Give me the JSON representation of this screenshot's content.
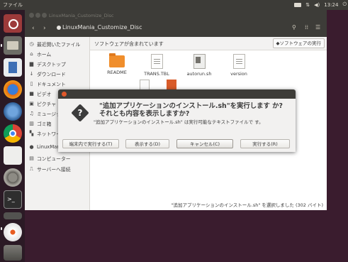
{
  "top_panel": {
    "app_title": "ファイル",
    "clock": "13:24",
    "tray_icons": [
      "keyboard-icon",
      "network-icon",
      "volume-icon",
      "power-icon"
    ]
  },
  "launcher": {
    "items": [
      "dash-icon",
      "files-icon",
      "writer-icon",
      "firefox-icon",
      "thunderbird-icon",
      "chrome-icon",
      "document-icon",
      "settings-icon",
      "terminal-icon",
      "small-app-icon",
      "dvd-icon",
      "trash-icon"
    ]
  },
  "window": {
    "title": "LinuxMania_Customize_Disc",
    "path_button": "LinuxMania_Customize_Disc",
    "back_glyph": "‹",
    "forward_glyph": "›",
    "search_glyph": "⚲",
    "view_glyph": "⁞⁞",
    "menu_glyph": "☰"
  },
  "sidebar": {
    "items": [
      {
        "label": "最近開いたファイル",
        "icon": "clock-icon",
        "glyph": "◷"
      },
      {
        "label": "ホーム",
        "icon": "home-icon",
        "glyph": "⌂"
      },
      {
        "label": "デスクトップ",
        "icon": "desktop-icon",
        "glyph": "▆"
      },
      {
        "label": "ダウンロード",
        "icon": "download-icon",
        "glyph": "↓"
      },
      {
        "label": "ドキュメント",
        "icon": "documents-icon",
        "glyph": "▯"
      },
      {
        "label": "ビデオ",
        "icon": "video-icon",
        "glyph": "■"
      },
      {
        "label": "ピクチャ",
        "icon": "pictures-icon",
        "glyph": "▣"
      },
      {
        "label": "ミュージック",
        "icon": "music-icon",
        "glyph": "♫"
      },
      {
        "label": "ゴミ箱",
        "icon": "trash-icon",
        "glyph": "▥"
      },
      {
        "label": "ネットワーク",
        "icon": "network-icon",
        "glyph": "▚"
      },
      {
        "label": "LinuxMania",
        "icon": "disc-icon",
        "glyph": "●"
      },
      {
        "label": "コンピューター",
        "icon": "computer-icon",
        "glyph": "▤"
      },
      {
        "label": "サーバーへ接続",
        "icon": "server-icon",
        "glyph": "⎍"
      }
    ]
  },
  "infobar": {
    "message": "ソフトウェアが含まれています",
    "run_button": "ソフトウェアの実行"
  },
  "files": [
    {
      "name": "README",
      "icon": "folder-icon"
    },
    {
      "name": "TRANS.TBL",
      "icon": "text-file-icon"
    },
    {
      "name": "autorun.sh",
      "icon": "script-file-icon"
    },
    {
      "name": "version",
      "icon": "text-file-icon"
    }
  ],
  "statusbar": {
    "text": "\"追加アプリケーションのインストール.sh\" を選択しました (302 バイト)"
  },
  "dialog": {
    "title": "\"追加アプリケーションのインストール.sh\"を実行します か? それとも内容を表示しますか?",
    "body": "\"追加アプリケーションのインストール.sh\" は実行可能なテキストファイルで す。",
    "buttons": {
      "run_in_terminal": "端末内で実行する(T)",
      "display": "表示する(D)",
      "cancel": "キャンセル(C)",
      "run": "実行する(R)"
    }
  }
}
